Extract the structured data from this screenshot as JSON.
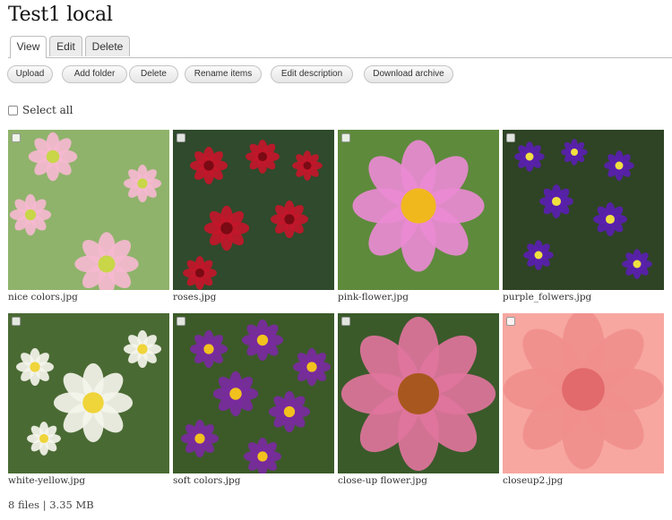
{
  "page": {
    "title": "Test1 local"
  },
  "tabs": [
    {
      "label": "View",
      "active": true
    },
    {
      "label": "Edit",
      "active": false
    },
    {
      "label": "Delete",
      "active": false
    }
  ],
  "toolbar": {
    "upload": "Upload",
    "add_folder": "Add folder",
    "delete": "Delete",
    "rename": "Rename items",
    "edit_description": "Edit description",
    "download_archive": "Download archive"
  },
  "select_all": {
    "label": "Select all",
    "checked": false
  },
  "files": [
    {
      "name": "nice colors.jpg",
      "bg": "#8fb36b",
      "petal": "#f5b8cf",
      "center": "#c8d648"
    },
    {
      "name": "roses.jpg",
      "bg": "#2f4a2c",
      "petal": "#c3162a",
      "center": "#7a0a14"
    },
    {
      "name": "pink-flower.jpg",
      "bg": "#5e8a3c",
      "petal": "#e98ad2",
      "center": "#f1b81e"
    },
    {
      "name": "purple_folwers.jpg",
      "bg": "#2e4424",
      "petal": "#5a1fb0",
      "center": "#f0e040"
    },
    {
      "name": "white-yellow.jpg",
      "bg": "#4a6a34",
      "petal": "#f4f4ea",
      "center": "#efd43a"
    },
    {
      "name": "soft colors.jpg",
      "bg": "#3c5a28",
      "petal": "#7a2aa0",
      "center": "#f1c21e"
    },
    {
      "name": "close-up flower.jpg",
      "bg": "#3a5a2a",
      "petal": "#e0749c",
      "center": "#a8581e"
    },
    {
      "name": "closeup2.jpg",
      "bg": "#f7a7a0",
      "petal": "#f08f8c",
      "center": "#e26a6c"
    }
  ],
  "footer": {
    "count": "8 files",
    "separator": "|",
    "size": "3.35 MB"
  }
}
